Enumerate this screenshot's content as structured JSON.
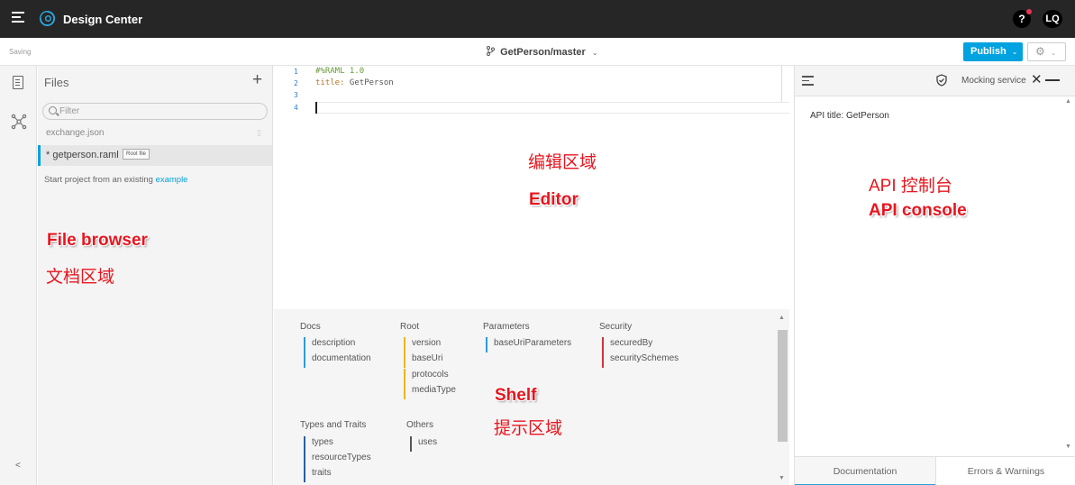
{
  "topbar": {
    "app_title": "Design Center",
    "help_label": "?",
    "avatar_initials": "LQ"
  },
  "subbar": {
    "status": "Saving",
    "branch": "GetPerson/master",
    "publish_label": "Publish"
  },
  "files": {
    "title": "Files",
    "filter_placeholder": "Filter",
    "items": [
      {
        "name": "exchange.json"
      },
      {
        "name": "* getperson.raml",
        "badge": "Root file"
      }
    ],
    "hint_prefix": "Start project from an existing ",
    "hint_link": "example"
  },
  "editor": {
    "lines": [
      {
        "num": "1",
        "comment": "#%RAML 1.0"
      },
      {
        "num": "2",
        "key": "title:",
        "value": " GetPerson"
      },
      {
        "num": "3"
      },
      {
        "num": "4"
      }
    ]
  },
  "shelf": {
    "docs": {
      "title": "Docs",
      "items": [
        "description",
        "documentation"
      ]
    },
    "root": {
      "title": "Root",
      "items": [
        "version",
        "baseUri",
        "protocols",
        "mediaType"
      ]
    },
    "parameters": {
      "title": "Parameters",
      "items": [
        "baseUriParameters"
      ]
    },
    "security": {
      "title": "Security",
      "items": [
        "securedBy",
        "securitySchemes"
      ]
    },
    "types": {
      "title": "Types and Traits",
      "items": [
        "types",
        "resourceTypes",
        "traits"
      ]
    },
    "others": {
      "title": "Others",
      "items": [
        "uses"
      ]
    }
  },
  "console": {
    "mocking_label": "Mocking service",
    "api_title": "API title: GetPerson",
    "tabs": [
      "Documentation",
      "Errors & Warnings"
    ]
  },
  "annotations": {
    "editor_cn": "编辑区域",
    "editor_en": "Editor",
    "console_cn": "API 控制台",
    "console_en": "API console",
    "files_en": "File browser",
    "files_cn": "文档区域",
    "shelf_en": "Shelf",
    "shelf_cn": "提示区域"
  },
  "colors": {
    "topbar_bg": "#262626",
    "accent": "#00a2df",
    "annotation": "#e8151e"
  }
}
